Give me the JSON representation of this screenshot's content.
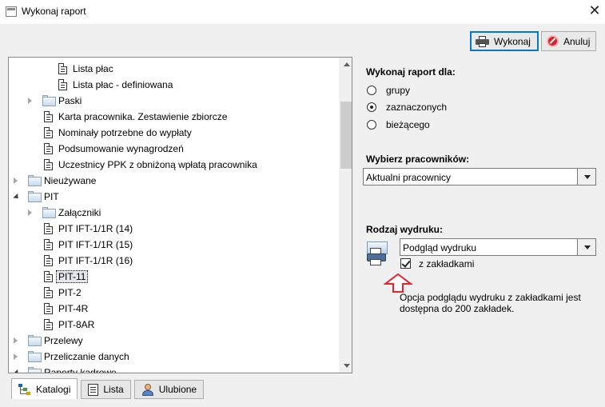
{
  "window": {
    "title": "Wykonaj raport",
    "close_icon": "close-icon"
  },
  "toolbar": {
    "run_label": "Wykonaj",
    "cancel_label": "Anuluj"
  },
  "tree": {
    "items": [
      {
        "label": "Lista płac",
        "type": "doc",
        "level": 3
      },
      {
        "label": "Lista płac - definiowana",
        "type": "doc",
        "level": 3
      },
      {
        "label": "Paski",
        "type": "folder",
        "level": 2,
        "expander": "collapsed"
      },
      {
        "label": "Karta pracownika. Zestawienie zbiorcze",
        "type": "doc",
        "level": 2
      },
      {
        "label": "Nominały potrzebne do wypłaty",
        "type": "doc",
        "level": 2
      },
      {
        "label": "Podsumowanie wynagrodzeń",
        "type": "doc",
        "level": 2
      },
      {
        "label": "Uczestnicy PPK z obniżoną wpłatą pracownika",
        "type": "doc",
        "level": 2
      },
      {
        "label": "Nieużywane",
        "type": "folder",
        "level": 1,
        "expander": "collapsed"
      },
      {
        "label": "PIT",
        "type": "folder",
        "level": 1,
        "expander": "expanded"
      },
      {
        "label": "Załączniki",
        "type": "folder",
        "level": 2,
        "expander": "collapsed"
      },
      {
        "label": "PIT IFT-1/1R (14)",
        "type": "doc",
        "level": 2
      },
      {
        "label": "PIT IFT-1/1R (15)",
        "type": "doc",
        "level": 2
      },
      {
        "label": "PIT IFT-1/1R (16)",
        "type": "doc",
        "level": 2
      },
      {
        "label": "PIT-11",
        "type": "doc",
        "level": 2,
        "selected": true
      },
      {
        "label": "PIT-2",
        "type": "doc",
        "level": 2
      },
      {
        "label": "PIT-4R",
        "type": "doc",
        "level": 2
      },
      {
        "label": "PIT-8AR",
        "type": "doc",
        "level": 2
      },
      {
        "label": "Przelewy",
        "type": "folder",
        "level": 1,
        "expander": "collapsed"
      },
      {
        "label": "Przeliczanie danych",
        "type": "folder",
        "level": 1,
        "expander": "collapsed"
      },
      {
        "label": "Raporty kadrowe",
        "type": "folder",
        "level": 1,
        "expander": "expanded"
      }
    ]
  },
  "tabs": [
    {
      "label": "Katalogi",
      "icon": "hierarchy-icon",
      "active": true
    },
    {
      "label": "Lista",
      "icon": "list-icon",
      "active": false
    },
    {
      "label": "Ulubione",
      "icon": "user-icon",
      "active": false
    }
  ],
  "report_for": {
    "title": "Wykonaj raport dla:",
    "options": [
      {
        "label": "grupy",
        "checked": false
      },
      {
        "label": "zaznaczonych",
        "checked": true
      },
      {
        "label": "bieżącego",
        "checked": false
      }
    ]
  },
  "employees": {
    "title": "Wybierz pracowników:",
    "value": "Aktualni pracownicy"
  },
  "print_type": {
    "title": "Rodzaj wydruku:",
    "value": "Podgląd wydruku",
    "with_bookmarks_label": "z zakładkami",
    "with_bookmarks_checked": true,
    "note": "Opcja podglądu wydruku z zakładkami jest dostępna do 200 zakładek."
  },
  "colors": {
    "selection": "#e5e5ec",
    "arrow": "#e3262e",
    "focus": "#0078d7"
  }
}
